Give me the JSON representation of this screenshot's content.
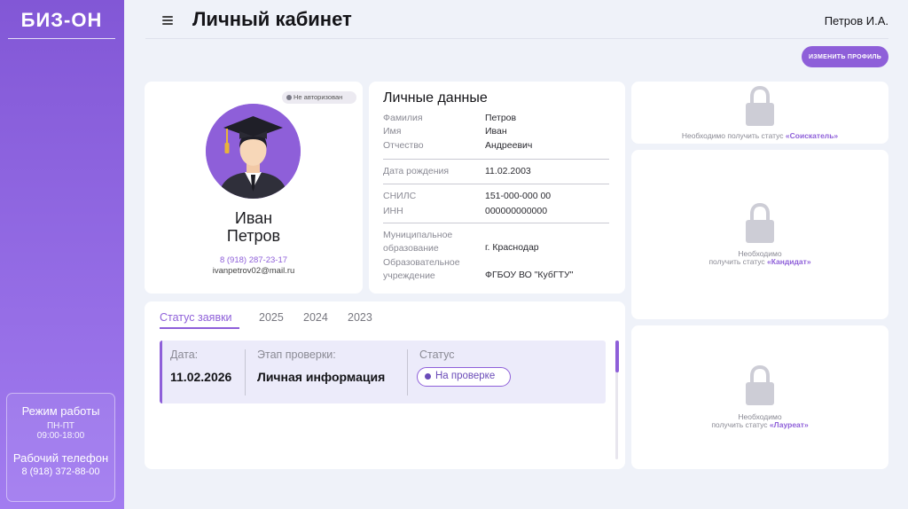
{
  "sidebar": {
    "logo": "БИЗ-ОН",
    "work_hours_title": "Режим работы",
    "work_days": "ПН-ПТ",
    "work_hours": "09:00-18:00",
    "phone_title": "Рабочий телефон",
    "phone": "8 (918) 372-88-00"
  },
  "header": {
    "title": "Личный кабинет",
    "user": "Петров И.А.",
    "edit_profile": "ИЗМЕНИТЬ ПРОФИЛЬ"
  },
  "profile": {
    "badge": "Не авторизован",
    "first_name": "Иван",
    "last_name": "Петров",
    "phone": "8 (918) 287-23-17",
    "email": "ivanpetrov02@mail.ru"
  },
  "personal": {
    "title": "Личные данные",
    "surname_label": "Фамилия",
    "surname": "Петров",
    "name_label": "Имя",
    "name": "Иван",
    "patronymic_label": "Отчество",
    "patronymic": "Андреевич",
    "birth_label": "Дата рождения",
    "birth": "11.02.2003",
    "snils_label": "СНИЛС",
    "snils": "151-000-000 00",
    "inn_label": "ИНН",
    "inn": "000000000000",
    "mun_label_1": "Муниципальное",
    "mun_label_2": "образование",
    "mun": "г. Краснодар",
    "edu_label_1": "Образовательное",
    "edu_label_2": "учреждение",
    "edu": "ФГБОУ ВО \"КубГТУ\""
  },
  "status": {
    "tabs": [
      "Статус заявки",
      "2025",
      "2024",
      "2023"
    ],
    "date_label": "Дата:",
    "date": "11.02.2026",
    "stage_label": "Этап проверки:",
    "stage": "Личная информация",
    "status_label": "Статус",
    "status": "На проверке"
  },
  "locks": {
    "l1_text": "Необходимо получить статус",
    "l1_status": "«Соискатель»",
    "l2_text_1": "Необходимо",
    "l2_text_2": "получить статус",
    "l2_status": "«Кандидат»",
    "l3_text_1": "Необходимо",
    "l3_text_2": "получить статус",
    "l3_status": "«Лауреат»"
  },
  "colors": {
    "accent": "#8e5fd9",
    "background": "#eff2f9"
  }
}
